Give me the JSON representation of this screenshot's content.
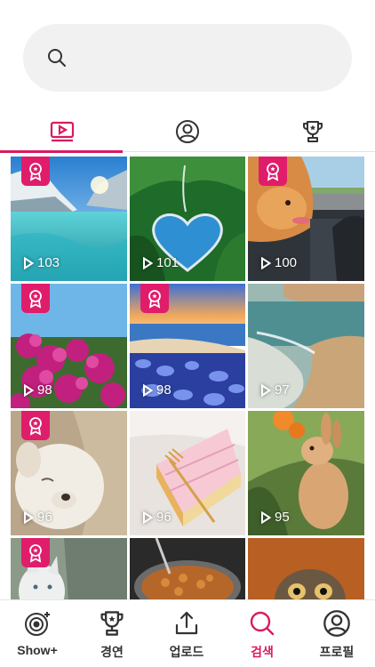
{
  "search": {
    "placeholder": "",
    "value": ""
  },
  "tabs": [
    {
      "icon": "video-icon",
      "active": true
    },
    {
      "icon": "user-circle-icon",
      "active": false
    },
    {
      "icon": "trophy-icon",
      "active": false
    }
  ],
  "grid": [
    {
      "views": "103",
      "badge": true
    },
    {
      "views": "101",
      "badge": false
    },
    {
      "views": "100",
      "badge": true
    },
    {
      "views": "98",
      "badge": true
    },
    {
      "views": "98",
      "badge": true
    },
    {
      "views": "97",
      "badge": false
    },
    {
      "views": "96",
      "badge": true
    },
    {
      "views": "96",
      "badge": false
    },
    {
      "views": "95",
      "badge": false
    },
    {
      "views": "",
      "badge": true
    },
    {
      "views": "",
      "badge": false
    },
    {
      "views": "",
      "badge": false
    }
  ],
  "nav": {
    "items": [
      {
        "label": "Show+",
        "icon": "show-plus-icon"
      },
      {
        "label": "경연",
        "icon": "trophy-icon"
      },
      {
        "label": "업로드",
        "icon": "upload-icon"
      },
      {
        "label": "검색",
        "icon": "search-icon"
      },
      {
        "label": "프로필",
        "icon": "profile-icon"
      }
    ],
    "active_index": 3
  },
  "colors": {
    "accent": "#d81b60",
    "badge": "#e01d6b"
  }
}
